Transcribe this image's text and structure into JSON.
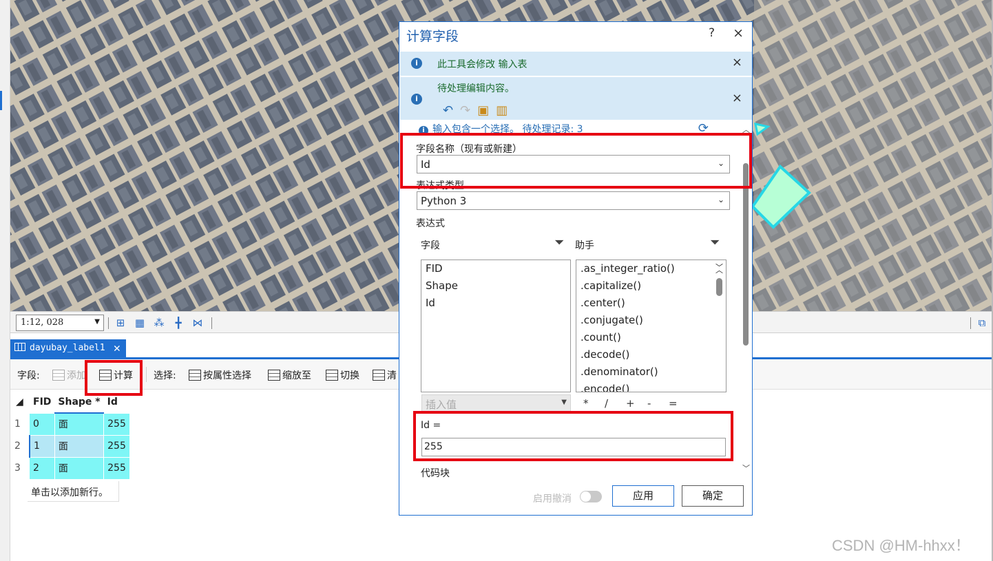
{
  "map": {
    "scale": "1:12, 028"
  },
  "table_tab": {
    "label": "dayubay_label1"
  },
  "table_toolbar": {
    "field_label": "字段:",
    "add_label": "添加",
    "calculate_label": "计算",
    "select_label": "选择:",
    "select_by_attr_label": "按属性选择",
    "zoom_to_label": "缩放至",
    "switch_label": "切换",
    "clear_label": "清"
  },
  "attribute_table": {
    "columns": [
      "FID",
      "Shape *",
      "Id"
    ],
    "rows": [
      {
        "num": "1",
        "fid": "0",
        "shape": "面",
        "id": "255"
      },
      {
        "num": "2",
        "fid": "1",
        "shape": "面",
        "id": "255"
      },
      {
        "num": "3",
        "fid": "2",
        "shape": "面",
        "id": "255"
      }
    ],
    "add_row_text": "单击以添加新行。"
  },
  "dialog": {
    "title": "计算字段",
    "help": "?",
    "close": "×",
    "message1": "此工具会修改 输入表",
    "message2": "待处理编辑内容。",
    "selection_note": "输入包含一个选择。 待处理记录: 3",
    "field_name_label": "字段名称（现有或新建）",
    "field_name_value": "Id",
    "expression_type_label": "表达式类型",
    "expression_type_value": "Python 3",
    "expression_label": "表达式",
    "fields_header": "字段",
    "helpers_header": "助手",
    "fields": [
      "FID",
      "Shape",
      "Id"
    ],
    "helpers": [
      ".as_integer_ratio()",
      ".capitalize()",
      ".center()",
      ".conjugate()",
      ".count()",
      ".decode()",
      ".denominator()",
      ".encode()"
    ],
    "insert_value_placeholder": "插入值",
    "operators": [
      "*",
      "/",
      "+",
      "-",
      "="
    ],
    "expression_target": "Id =",
    "expression_value": "255",
    "code_block_label": "代码块",
    "enable_undo_label": "启用撤消",
    "apply_label": "应用",
    "ok_label": "确定"
  },
  "watermark": "CSDN @HM-hhxx！"
}
